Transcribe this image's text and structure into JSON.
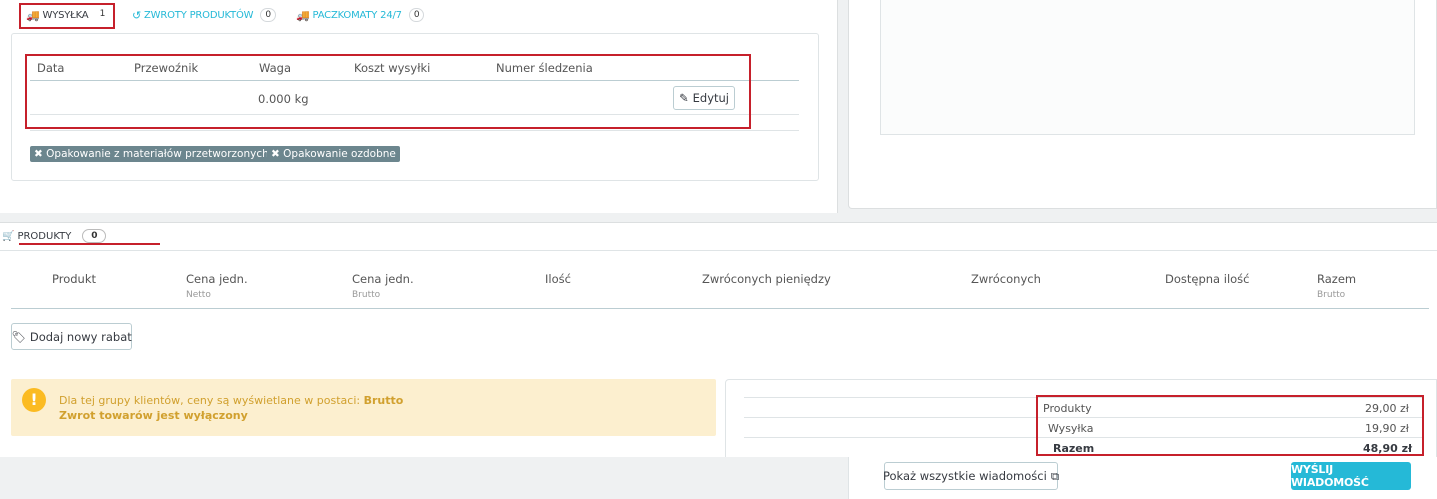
{
  "tabs": [
    {
      "label": "WYSYŁKA",
      "count": "1",
      "icon": "truck-icon"
    },
    {
      "label": "ZWROTY PRODUKTÓW",
      "count": "0",
      "icon": "undo-icon"
    },
    {
      "label": "PACZKOMATY 24/7",
      "count": "0",
      "icon": "truck-icon"
    }
  ],
  "shipping": {
    "headers": [
      "Data",
      "Przewoźnik",
      "Waga",
      "Koszt wysyłki",
      "Numer śledzenia"
    ],
    "row": {
      "weight": "0.000 kg"
    },
    "edit_label": "Edytuj",
    "tags": [
      "Opakowanie z materiałów przetworzonych",
      "Opakowanie ozdobne"
    ]
  },
  "products": {
    "title": "PRODUKTY",
    "count": "0",
    "columns": [
      {
        "label": "Produkt",
        "sub": ""
      },
      {
        "label": "Cena jedn.",
        "sub": "Netto"
      },
      {
        "label": "Cena jedn.",
        "sub": "Brutto"
      },
      {
        "label": "Ilość",
        "sub": ""
      },
      {
        "label": "Zwróconych pieniędzy",
        "sub": ""
      },
      {
        "label": "Zwróconych",
        "sub": ""
      },
      {
        "label": "Dostępna ilość",
        "sub": ""
      },
      {
        "label": "Razem",
        "sub": "Brutto"
      }
    ],
    "add_discount_label": "Dodaj nowy rabat"
  },
  "alert": {
    "text": "Dla tej grupy klientów, ceny są wyświetlane w postaci:",
    "text_bold": "Brutto",
    "line2": "Zwrot towarów jest wyłączony"
  },
  "totals": [
    {
      "label": "Produkty",
      "value": "29,00 zł"
    },
    {
      "label": "Wysyłka",
      "value": "19,90 zł"
    },
    {
      "label": "Razem",
      "value": "48,90 zł"
    }
  ],
  "messages": {
    "show_all_label": "Pokaż wszystkie wiadomości",
    "send_label": "WYŚLIJ WIADOMOŚĆ"
  },
  "colors": {
    "accent": "#25b9d7",
    "highlight": "#c6202b",
    "warning_bg": "#fcefcf"
  }
}
